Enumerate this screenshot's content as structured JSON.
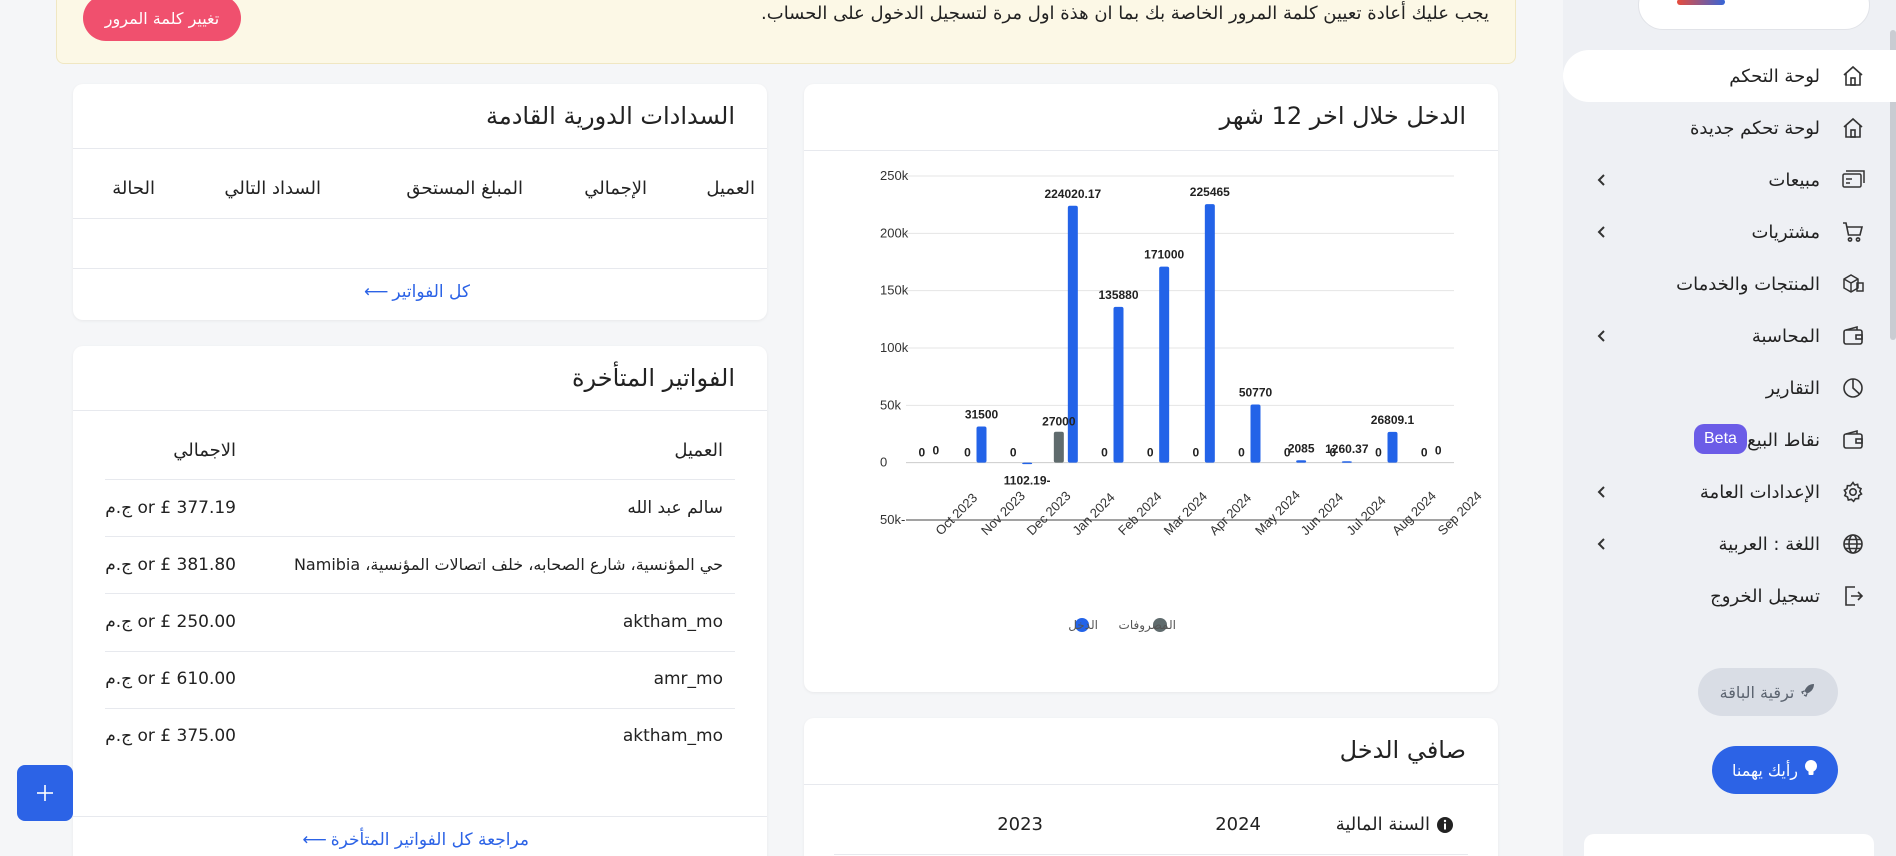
{
  "alert": {
    "message": "يجب عليك أعادة تعيين كلمة المرور الخاصة بك بما ان هذة اول مرة لتسجيل الدخول على الحساب.",
    "button": "تغيير كلمة المرور"
  },
  "sidebar": {
    "items": [
      {
        "label": "لوحة التحكم",
        "icon": "home-icon",
        "chevron": false,
        "active": true
      },
      {
        "label": "لوحة تحكم جديدة",
        "icon": "home-icon",
        "chevron": false
      },
      {
        "label": "مبيعات",
        "icon": "sales-icon",
        "chevron": true
      },
      {
        "label": "مشتريات",
        "icon": "cart-icon",
        "chevron": true
      },
      {
        "label": "المنتجات والخدمات",
        "icon": "boxes-icon",
        "chevron": false
      },
      {
        "label": "المحاسبة",
        "icon": "wallet-icon",
        "chevron": true
      },
      {
        "label": "التقارير",
        "icon": "pie-chart-icon",
        "chevron": false
      },
      {
        "label": "نقاط البيع",
        "icon": "wallet-icon",
        "chevron": false,
        "badge": "Beta"
      },
      {
        "label": "الإعدادات العامة",
        "icon": "gear-icon",
        "chevron": true
      },
      {
        "label": "اللغة : العربية",
        "icon": "globe-icon",
        "chevron": true
      },
      {
        "label": "تسجيل الخروج",
        "icon": "logout-icon",
        "chevron": false
      }
    ],
    "upgrade": "ترقية الباقة",
    "opinion": "رأيك يهمنا"
  },
  "income_card": {
    "title": "الدخل خلال اخر 12 شهر"
  },
  "chart_data": {
    "type": "bar",
    "categories": [
      "Oct 2023",
      "Nov 2023",
      "Dec 2023",
      "Jan 2024",
      "Feb 2024",
      "Mar 2024",
      "Apr 2024",
      "May 2024",
      "Jun 2024",
      "Jul 2024",
      "Aug 2024",
      "Sep 2024"
    ],
    "series": [
      {
        "name": "المصروفات",
        "color": "#5f6b6d",
        "values": [
          0,
          0,
          0,
          27000,
          0,
          0,
          0,
          0,
          0,
          0,
          0,
          0
        ]
      },
      {
        "name": "الدخل",
        "color": "#2363e8",
        "values": [
          0,
          31500,
          -1102.19,
          224020.17,
          135880,
          171000,
          225465,
          50770,
          2085,
          1260.37,
          26809.1,
          0
        ]
      }
    ],
    "yticks": [
      "250k",
      "200k",
      "150k",
      "100k",
      "50k",
      "0",
      "-50k"
    ],
    "ylim": [
      -50000,
      250000
    ],
    "legend": "bottom"
  },
  "recurring_card": {
    "title": "السدادات الدورية القادمة",
    "headers": [
      "العميل",
      "الإجمالي",
      "المبلغ المستحق",
      "السداد التالي",
      "الحالة"
    ],
    "link": "كل الفواتير"
  },
  "overdue_card": {
    "title": "الفواتير المتأخرة",
    "headers": [
      "العميل",
      "الاجمالي"
    ],
    "rows": [
      {
        "client": "سالم عبد الله",
        "total": "377.19 £ or ج.م"
      },
      {
        "client": "حي المؤنسية، شارع الصحابه، خلف اتصالات المؤنسية، Namibia",
        "total": "381.80 £ or ج.م"
      },
      {
        "client": "aktham_mo",
        "total": "250.00 £ or ج.م"
      },
      {
        "client": "amr_mo",
        "total": "610.00 £ or ج.م"
      },
      {
        "client": "aktham_mo",
        "total": "375.00 £ or ج.م"
      }
    ],
    "link": "مراجعة كل الفواتير المتأخرة"
  },
  "net_card": {
    "title": "صافي الدخل",
    "headers": [
      "السنة المالية",
      "2024",
      "2023"
    ]
  },
  "fab": "+"
}
